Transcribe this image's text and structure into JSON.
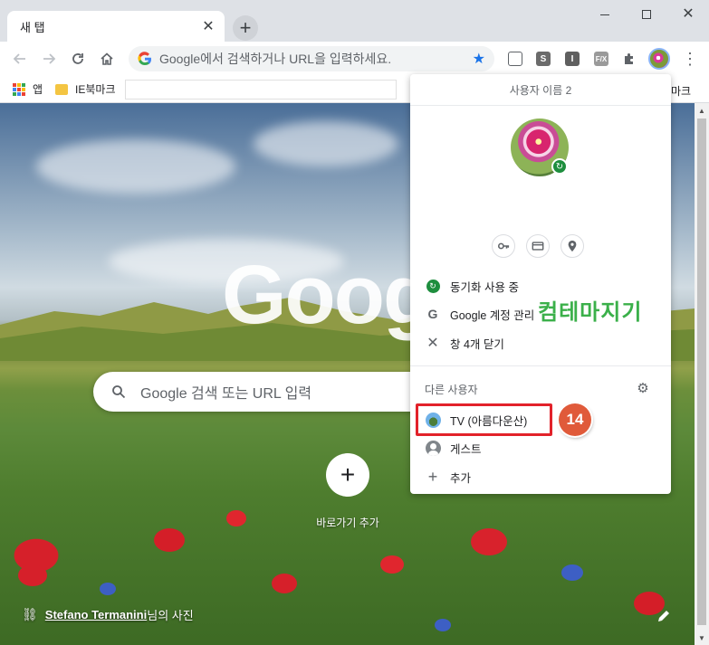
{
  "tab": {
    "title": "새 탭",
    "close_glyph": "✕"
  },
  "newtab_glyph": "+",
  "window_controls": {
    "close_glyph": "✕"
  },
  "omnibox": {
    "placeholder": "Google에서 검색하거나 URL을 입력하세요."
  },
  "extensions": {
    "e2": "S",
    "e3": "I",
    "e4": "F/X"
  },
  "menu_glyph": "⋮",
  "bookmarks": {
    "apps_label": "앱",
    "ie_label": "IE북마크",
    "trailing_text": "마크"
  },
  "ntp": {
    "logo": "Goog",
    "search_placeholder": "Google 검색 또는 URL 입력",
    "shortcut_add_glyph": "+",
    "shortcut_label": "바로가기 추가",
    "attribution_author": "Stefano Termanini",
    "attribution_suffix": "님의 사진"
  },
  "profile_menu": {
    "title": "사용자 이름 2",
    "sync_label": "동기화 사용 중",
    "manage_account_label": "Google 계정 관리",
    "close_windows_label": "창 4개 닫기",
    "other_people_label": "다른 사용자",
    "profile_tv_label": "TV (아름다운산)",
    "guest_label": "게스트",
    "add_label": "추가"
  },
  "annotation": {
    "step_number": "14",
    "watermark": "컴테마지기"
  },
  "colors": {
    "accent": "#1a73e8",
    "sync_green": "#1e8e3e",
    "highlight_red": "#e2222a",
    "badge_orange": "#e05a3a"
  },
  "icons": [
    "back-icon",
    "forward-icon",
    "reload-icon",
    "home-icon",
    "google-g-icon",
    "star-icon",
    "puzzle-icon",
    "key-icon",
    "card-icon",
    "location-icon",
    "sync-icon",
    "gear-icon",
    "guest-icon",
    "plus-icon",
    "link-icon",
    "pencil-icon"
  ]
}
